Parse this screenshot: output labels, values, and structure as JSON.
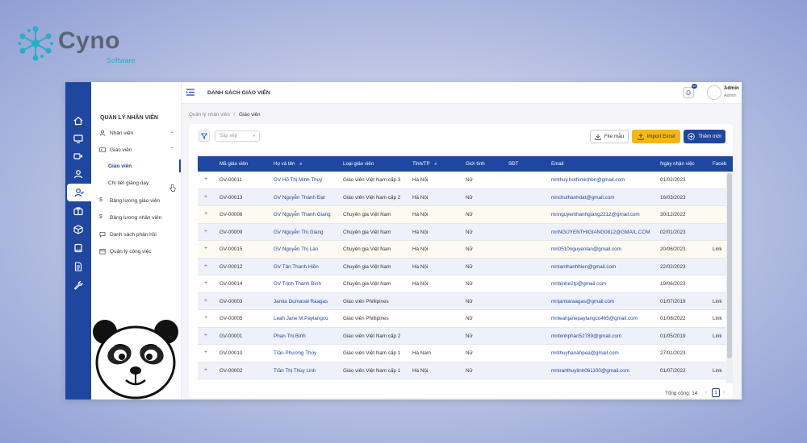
{
  "brand": {
    "name": "Cyno",
    "subtitle": "Software"
  },
  "colors": {
    "primary": "#1f47a0",
    "accent": "#f6b618",
    "brand_teal": "#27aec9"
  },
  "rail_icons": [
    "home-icon",
    "monitor-icon",
    "video-icon",
    "user-icon",
    "user-check-icon",
    "briefcase-icon",
    "box-icon",
    "book-icon",
    "document-icon",
    "wrench-icon"
  ],
  "sidebar": {
    "title": "QUẢN LÝ NHÂN VIÊN",
    "items": [
      {
        "label": "Nhân viên",
        "icon": "person-icon",
        "caret": "⌄"
      },
      {
        "label": "Giáo viên",
        "icon": "id-card-icon",
        "caret": "⌃"
      },
      {
        "label": "Bảng lương giáo viên",
        "icon": "dollar-icon"
      },
      {
        "label": "Bảng lương nhân viên",
        "icon": "dollar-icon"
      },
      {
        "label": "Danh sách phản hồi",
        "icon": "chat-icon"
      },
      {
        "label": "Quản lý công việc",
        "icon": "calendar-icon"
      }
    ],
    "subitems": [
      {
        "label": "Giáo viên",
        "active": true
      },
      {
        "label": "Chi tiết giảng dạy",
        "active": false
      }
    ]
  },
  "topbar": {
    "title": "DANH SÁCH GIÁO VIÊN",
    "notification_count": "99",
    "user_name": "Admin",
    "user_role": "Admin"
  },
  "breadcrumb": {
    "parent": "Quản lý nhân viên",
    "separator": "/",
    "current": "Giáo viên"
  },
  "toolbar": {
    "sort_placeholder": "Sắp xếp",
    "file_label": "File mẫu",
    "import_label": "Import Excel",
    "add_label": "Thêm mới"
  },
  "table": {
    "headers": [
      "Mã giáo viên",
      "Họ và tên",
      "Loại giáo viên",
      "Tỉnh/TP",
      "Giới tính",
      "SĐT",
      "Email",
      "Ngày nhận việc",
      "Faceb"
    ],
    "rows": [
      {
        "code": "GV-00011",
        "name": "GV Hồ Thị Minh Thuý",
        "type": "Giáo viên Việt Nam cấp 3",
        "city": "Hà Nội",
        "gender": "Nữ",
        "phone": "",
        "email": "mnthuy.hothiminhbn@gmail.com",
        "date": "01/02/2023",
        "fb": ""
      },
      {
        "code": "GV-00013",
        "name": "GV Nguyễn Thành Đạt",
        "type": "Giáo viên Việt Nam cấp 2",
        "city": "Hà Nội",
        "gender": "Nữ",
        "phone": "",
        "email": "mnchuthanhdat@gmail.com",
        "date": "16/03/2023",
        "fb": ""
      },
      {
        "code": "GV-00006",
        "name": "GV Nguyễn Thanh Giang",
        "type": "Chuyên gia Việt Nam",
        "city": "Hà Nội",
        "gender": "Nữ",
        "phone": "",
        "email": "mnnguyenthanhgiang2212@gmail.com",
        "date": "30/12/2022",
        "fb": ""
      },
      {
        "code": "GV-00009",
        "name": "GV Nguyễn Thị Giang",
        "type": "Chuyên gia Việt Nam",
        "city": "Hà Nội",
        "gender": "Nữ",
        "phone": "",
        "email": "mnNGUYENTHIGIANG0812@GMAIL.COM",
        "date": "02/01/2023",
        "fb": ""
      },
      {
        "code": "GV-00015",
        "name": "GV Nguyễn Thị Lan",
        "type": "Chuyên gia Việt Nam",
        "city": "Hà Nội",
        "gender": "Nữ",
        "phone": "",
        "email": "mn0510nguyenlan@gmail.com",
        "date": "20/06/2023",
        "fb": "Link"
      },
      {
        "code": "GV-00012",
        "name": "GV Tân Thanh Hiền",
        "type": "Chuyên gia Việt Nam",
        "city": "Hà Nội",
        "gender": "Nữ",
        "phone": "",
        "email": "mntanthanhhien@gmail.com",
        "date": "22/02/2023",
        "fb": ""
      },
      {
        "code": "GV-00014",
        "name": "GV Trịnh Thanh Bình",
        "type": "Chuyên gia Việt Nam",
        "city": "Hà Nội",
        "gender": "Nữ",
        "phone": "",
        "email": "mnbinhe2tp@gmail.com",
        "date": "19/06/2023",
        "fb": ""
      },
      {
        "code": "GV-00003",
        "name": "Jamia Dumaoal Raagas",
        "type": "Giáo viên Phillipines",
        "city": "",
        "gender": "Nữ",
        "phone": "",
        "email": "mnjamiaraagas@gmail.com",
        "date": "01/07/2019",
        "fb": "Link"
      },
      {
        "code": "GV-00005",
        "name": "Leah Jane M.Paylangco",
        "type": "Giáo viên Phillipines",
        "city": "",
        "gender": "Nữ",
        "phone": "",
        "email": "mnleahjanepaylangco465@gmail.com",
        "date": "01/08/2022",
        "fb": "Link"
      },
      {
        "code": "GV-00001",
        "name": "Phan Thị Bình",
        "type": "Giáo viên Việt Nam cấp 2",
        "city": "",
        "gender": "Nữ",
        "phone": "",
        "email": "mnbinhphan52789@gmail.com",
        "date": "01/05/2019",
        "fb": "Link"
      },
      {
        "code": "GV-00010",
        "name": "Trần Phương Thúy",
        "type": "Giáo viên Việt Nam cấp 1",
        "city": "Hà Nam",
        "gender": "Nữ",
        "phone": "",
        "email": "mnthuyhanahpea@gmail.com",
        "date": "27/01/2023",
        "fb": ""
      },
      {
        "code": "GV-00002",
        "name": "Trần Thị Thùy Linh",
        "type": "Giáo viên Việt Nam cấp 1",
        "city": "Hà Nội",
        "gender": "Nữ",
        "phone": "",
        "email": "mntranthuylinh061100@gmail.com",
        "date": "01/07/2022",
        "fb": "Link"
      }
    ]
  },
  "pagination": {
    "total_label": "Tổng cộng: 14",
    "current_page": "1",
    "prev": "‹",
    "next": "›"
  }
}
